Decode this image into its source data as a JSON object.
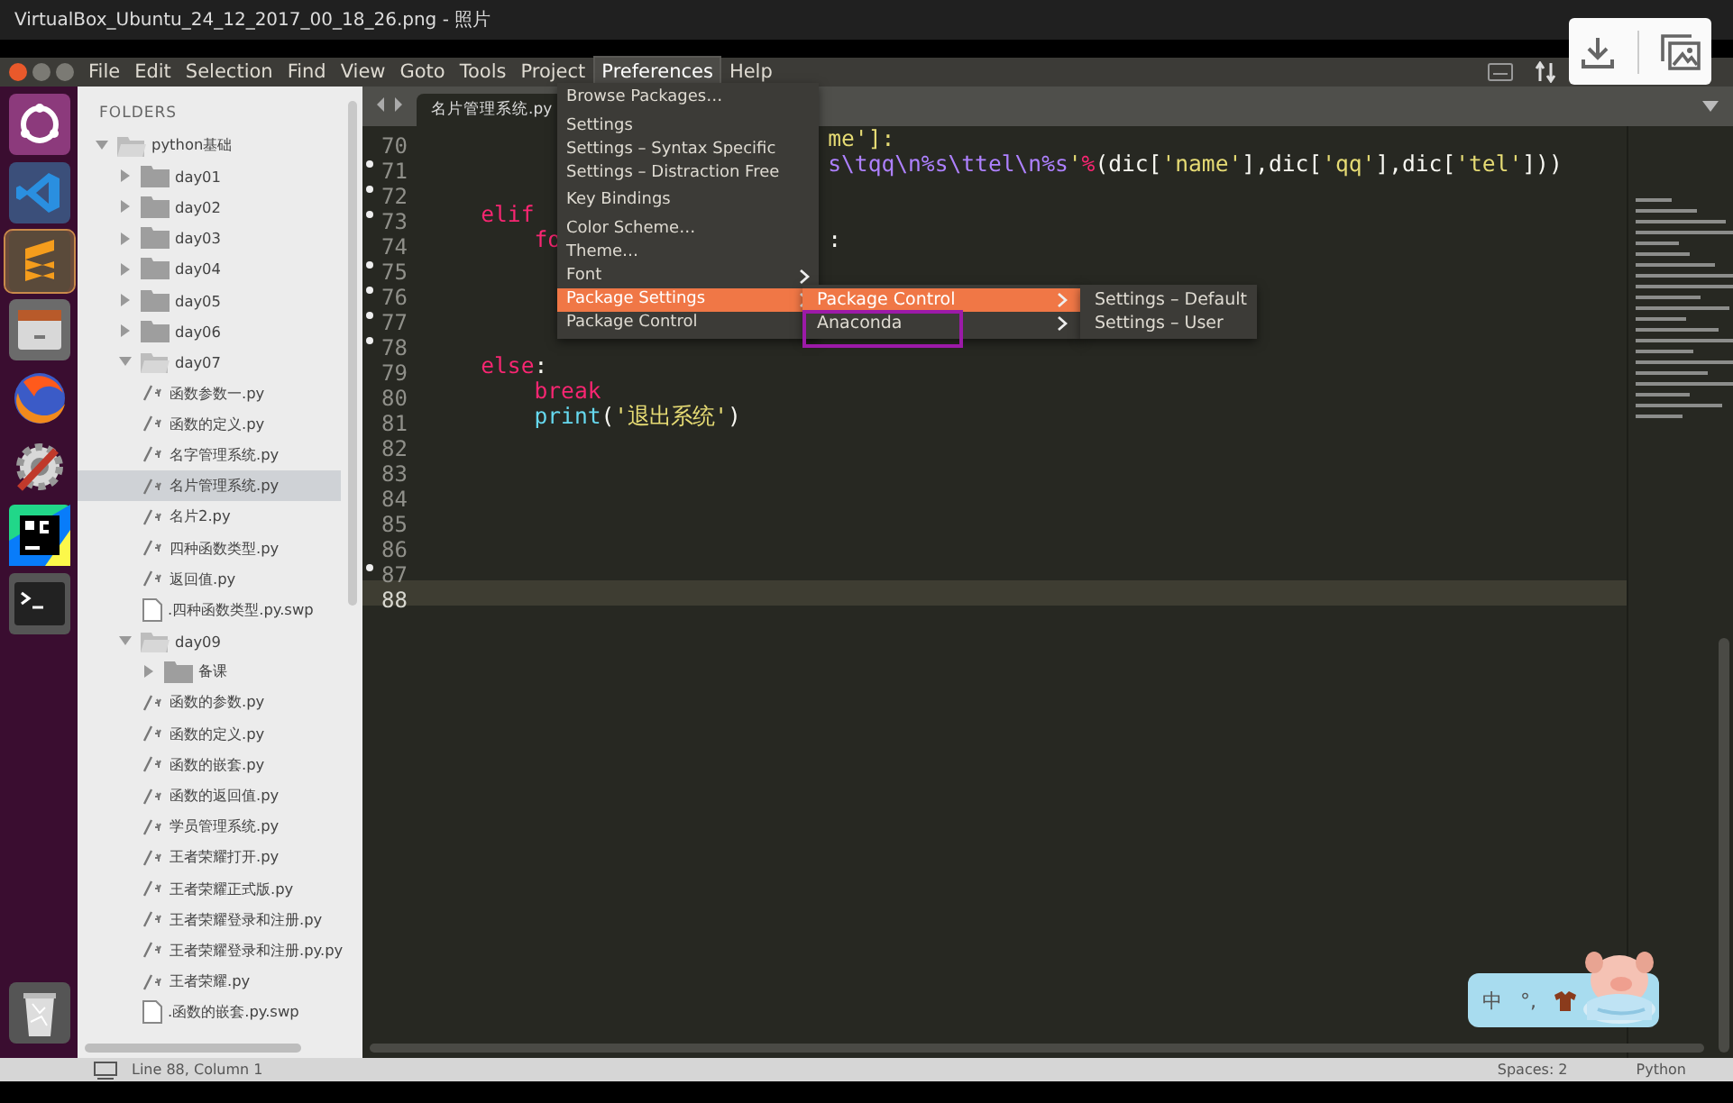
{
  "viewer": {
    "title": "VirtualBox_Ubuntu_24_12_2017_00_18_26.png - 照片"
  },
  "menu_bar": [
    {
      "label": "File",
      "selected": false
    },
    {
      "label": "Edit",
      "selected": false
    },
    {
      "label": "Selection",
      "selected": false
    },
    {
      "label": "Find",
      "selected": false
    },
    {
      "label": "View",
      "selected": false
    },
    {
      "label": "Goto",
      "selected": false
    },
    {
      "label": "Tools",
      "selected": false
    },
    {
      "label": "Project",
      "selected": false
    },
    {
      "label": "Preferences",
      "selected": true
    },
    {
      "label": "Help",
      "selected": false
    }
  ],
  "sidebar": {
    "title": "FOLDERS",
    "tree": [
      {
        "label": "python基础",
        "kind": "folder",
        "expanded": true,
        "selected": false,
        "children": [
          {
            "label": "day01",
            "kind": "folder",
            "expanded": false,
            "selected": false
          },
          {
            "label": "day02",
            "kind": "folder",
            "expanded": false,
            "selected": false
          },
          {
            "label": "day03",
            "kind": "folder",
            "expanded": false,
            "selected": false
          },
          {
            "label": "day04",
            "kind": "folder",
            "expanded": false,
            "selected": false
          },
          {
            "label": "day05",
            "kind": "folder",
            "expanded": false,
            "selected": false
          },
          {
            "label": "day06",
            "kind": "folder",
            "expanded": false,
            "selected": false
          },
          {
            "label": "day07",
            "kind": "folder",
            "expanded": true,
            "selected": false,
            "children": [
              {
                "label": "函数参数一.py",
                "kind": "code",
                "selected": false
              },
              {
                "label": "函数的定义.py",
                "kind": "code",
                "selected": false
              },
              {
                "label": "名字管理系统.py",
                "kind": "code",
                "selected": false
              },
              {
                "label": "名片管理系统.py",
                "kind": "code",
                "selected": true
              },
              {
                "label": "名片2.py",
                "kind": "code",
                "selected": false
              },
              {
                "label": "四种函数类型.py",
                "kind": "code",
                "selected": false
              },
              {
                "label": "返回值.py",
                "kind": "code",
                "selected": false
              },
              {
                "label": ".四种函数类型.py.swp",
                "kind": "file",
                "selected": false
              }
            ]
          },
          {
            "label": "day09",
            "kind": "folder",
            "expanded": true,
            "selected": false,
            "children": [
              {
                "label": "备课",
                "kind": "folder",
                "expanded": false,
                "selected": false
              },
              {
                "label": "函数的参数.py",
                "kind": "code",
                "selected": false
              },
              {
                "label": "函数的定义.py",
                "kind": "code",
                "selected": false
              },
              {
                "label": "函数的嵌套.py",
                "kind": "code",
                "selected": false
              },
              {
                "label": "函数的返回值.py",
                "kind": "code",
                "selected": false
              },
              {
                "label": "学员管理系统.py",
                "kind": "code",
                "selected": false
              },
              {
                "label": "王者荣耀打开.py",
                "kind": "code",
                "selected": false
              },
              {
                "label": "王者荣耀正式版.py",
                "kind": "code",
                "selected": false
              },
              {
                "label": "王者荣耀登录和注册.py",
                "kind": "code",
                "selected": false
              },
              {
                "label": "王者荣耀登录和注册.py.py",
                "kind": "code",
                "selected": false
              },
              {
                "label": "王者荣耀.py",
                "kind": "code",
                "selected": false
              },
              {
                "label": ".函数的嵌套.py.swp",
                "kind": "file",
                "selected": false
              }
            ]
          }
        ]
      }
    ]
  },
  "tabs": [
    {
      "label": "名片管理系统.py",
      "selected": true
    }
  ],
  "code_lines": [
    {
      "number": "70",
      "modified": false,
      "current": false,
      "tokens": [
        {
          "text": "                              me']:",
          "kind": "string"
        }
      ]
    },
    {
      "number": "71",
      "modified": true,
      "current": false,
      "tokens": [
        {
          "text": "                              s\\tqq\\n%s\\ttel\\n%s",
          "kind": "escape"
        },
        {
          "text": "'",
          "kind": "string"
        },
        {
          "text": "%",
          "kind": "keyword"
        },
        {
          "text": "(dic[",
          "kind": "plain"
        },
        {
          "text": "'name'",
          "kind": "string"
        },
        {
          "text": "],dic[",
          "kind": "plain"
        },
        {
          "text": "'qq'",
          "kind": "string"
        },
        {
          "text": "],dic[",
          "kind": "plain"
        },
        {
          "text": "'tel'",
          "kind": "string"
        },
        {
          "text": "]))",
          "kind": "plain"
        }
      ]
    },
    {
      "number": "72",
      "modified": true,
      "current": false
    },
    {
      "number": "73",
      "modified": true,
      "current": false,
      "tokens": [
        {
          "text": "    elif",
          "kind": "keyword"
        }
      ]
    },
    {
      "number": "74",
      "modified": false,
      "current": false,
      "tokens": [
        {
          "text": "        fo",
          "kind": "keyword"
        },
        {
          "text": "                    :",
          "kind": "plain"
        }
      ]
    },
    {
      "number": "75",
      "modified": true,
      "current": false
    },
    {
      "number": "76",
      "modified": true,
      "current": false
    },
    {
      "number": "77",
      "modified": true,
      "current": false
    },
    {
      "number": "78",
      "modified": true,
      "current": false
    },
    {
      "number": "79",
      "modified": false,
      "current": false,
      "tokens": [
        {
          "text": "    else",
          "kind": "keyword"
        },
        {
          "text": ":",
          "kind": "plain"
        }
      ]
    },
    {
      "number": "80",
      "modified": false,
      "current": false,
      "tokens": [
        {
          "text": "        break",
          "kind": "keyword"
        }
      ]
    },
    {
      "number": "81",
      "modified": false,
      "current": false,
      "tokens": [
        {
          "text": "        print",
          "kind": "builtin"
        },
        {
          "text": "(",
          "kind": "plain"
        },
        {
          "text": "'退出系统'",
          "kind": "string"
        },
        {
          "text": ")",
          "kind": "plain"
        }
      ]
    },
    {
      "number": "82",
      "modified": false,
      "current": false
    },
    {
      "number": "83",
      "modified": false,
      "current": false
    },
    {
      "number": "84",
      "modified": false,
      "current": false
    },
    {
      "number": "85",
      "modified": false,
      "current": false
    },
    {
      "number": "86",
      "modified": false,
      "current": false
    },
    {
      "number": "87",
      "modified": true,
      "current": false
    },
    {
      "number": "88",
      "modified": false,
      "current": true
    }
  ],
  "preferences_menu": [
    {
      "label": "Browse Packages…",
      "kind": "item",
      "selected": false
    },
    {
      "kind": "separator"
    },
    {
      "label": "Settings",
      "kind": "item",
      "selected": false
    },
    {
      "label": "Settings – Syntax Specific",
      "kind": "item",
      "selected": false
    },
    {
      "label": "Settings – Distraction Free",
      "kind": "item",
      "selected": false
    },
    {
      "kind": "separator"
    },
    {
      "label": "Key Bindings",
      "kind": "item",
      "selected": false
    },
    {
      "kind": "separator"
    },
    {
      "label": "Color Scheme…",
      "kind": "item",
      "selected": false
    },
    {
      "label": "Theme…",
      "kind": "item",
      "selected": false
    },
    {
      "label": "Font",
      "kind": "submenu",
      "selected": false
    },
    {
      "label": "Package Settings",
      "kind": "submenu",
      "selected": true
    },
    {
      "label": "Package Control",
      "kind": "item",
      "selected": false
    }
  ],
  "package_settings_menu": [
    {
      "label": "Package Control",
      "kind": "submenu",
      "selected": true
    },
    {
      "label": "Anaconda",
      "kind": "submenu",
      "selected": false
    }
  ],
  "package_control_menu": [
    {
      "label": "Settings – Default",
      "kind": "item",
      "selected": false
    },
    {
      "label": "Settings – User",
      "kind": "item",
      "selected": false
    }
  ],
  "status_bar": {
    "position": "Line 88, Column 1",
    "indentation": "Spaces: 2",
    "syntax": "Python"
  },
  "input_method": {
    "mode": "中",
    "punctuation": "°,"
  }
}
